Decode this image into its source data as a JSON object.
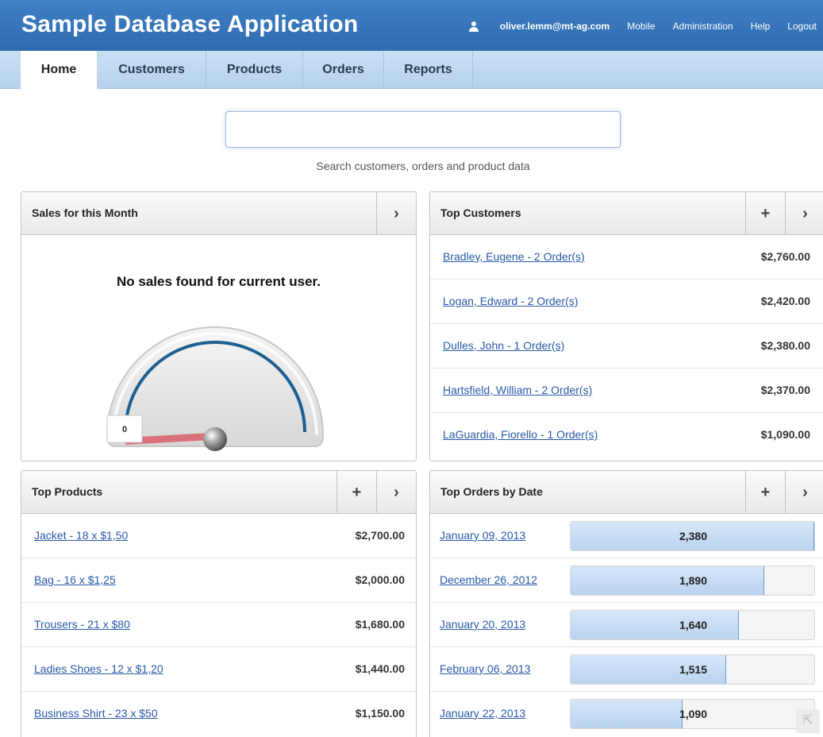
{
  "header": {
    "title": "Sample Database Application",
    "user": "oliver.lemm@mt-ag.com",
    "links": [
      "Mobile",
      "Administration",
      "Help",
      "Logout"
    ]
  },
  "tabs": [
    "Home",
    "Customers",
    "Products",
    "Orders",
    "Reports"
  ],
  "search": {
    "value": "",
    "hint": "Search customers, orders and product data"
  },
  "sales": {
    "title": "Sales for this Month",
    "message": "No sales found for current user.",
    "gauge_value": "0"
  },
  "top_customers": {
    "title": "Top Customers",
    "rows": [
      {
        "label": "Bradley, Eugene - 2 Order(s)",
        "value": "$2,760.00"
      },
      {
        "label": "Logan, Edward - 2 Order(s)",
        "value": "$2,420.00"
      },
      {
        "label": "Dulles, John - 1 Order(s)",
        "value": "$2,380.00"
      },
      {
        "label": "Hartsfield, William - 2 Order(s)",
        "value": "$2,370.00"
      },
      {
        "label": "LaGuardia, Fiorello - 1 Order(s)",
        "value": "$1,090.00"
      }
    ]
  },
  "top_products": {
    "title": "Top Products",
    "rows": [
      {
        "label": "Jacket - 18 x $1,50",
        "value": "$2,700.00"
      },
      {
        "label": "Bag - 16 x $1,25",
        "value": "$2,000.00"
      },
      {
        "label": "Trousers - 21 x $80",
        "value": "$1,680.00"
      },
      {
        "label": "Ladies Shoes - 12 x $1,20",
        "value": "$1,440.00"
      },
      {
        "label": "Business Shirt - 23 x $50",
        "value": "$1,150.00"
      }
    ]
  },
  "top_orders": {
    "title": "Top Orders by Date",
    "rows": [
      {
        "label": "January 09, 2013",
        "value": "2,380",
        "fraction": 1.0
      },
      {
        "label": "December 26, 2012",
        "value": "1,890",
        "fraction": 0.794
      },
      {
        "label": "January 20, 2013",
        "value": "1,640",
        "fraction": 0.689
      },
      {
        "label": "February 06, 2013",
        "value": "1,515",
        "fraction": 0.637
      },
      {
        "label": "January 22, 2013",
        "value": "1,090",
        "fraction": 0.458
      }
    ]
  },
  "colors": {
    "header": "#2f6cb1",
    "tabbar": "#b7d1ee",
    "link": "#2a5aa8",
    "gauge_arc": "#1f5f8f",
    "gauge_needle": "#d9707a"
  }
}
